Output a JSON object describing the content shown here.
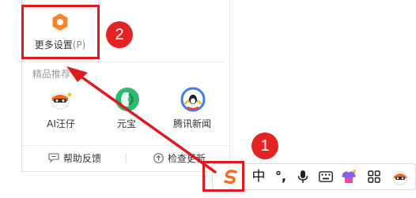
{
  "popup": {
    "settings": {
      "label": "更多设置",
      "shortcut": "(P)",
      "icon": "settings-hex-icon",
      "icon_color": "#f5832a"
    },
    "section_title": "精品推荐",
    "apps": [
      {
        "label": "AI汪仔",
        "icon": "ai-wangzai-icon"
      },
      {
        "label": "元宝",
        "icon": "yuanbao-icon"
      },
      {
        "label": "腾讯新闻",
        "icon": "tencent-news-icon"
      }
    ],
    "footer": {
      "help_label": "帮助反馈",
      "update_label": "检查更新"
    }
  },
  "toolbar": {
    "items": [
      {
        "label": "S",
        "icon": "sogou-logo-icon",
        "color": "#f26a1b"
      },
      {
        "label": "中",
        "icon": "chinese-mode"
      },
      {
        "label": "°,",
        "icon": "punctuation-mode"
      },
      {
        "label": "",
        "icon": "microphone-icon"
      },
      {
        "label": "",
        "icon": "keyboard-icon"
      },
      {
        "label": "",
        "icon": "skin-icon"
      },
      {
        "label": "",
        "icon": "grid-icon"
      },
      {
        "label": "",
        "icon": "avatar-icon"
      }
    ]
  },
  "annotations": {
    "badge_1": "1",
    "badge_2": "2",
    "color": "#e0191e"
  }
}
